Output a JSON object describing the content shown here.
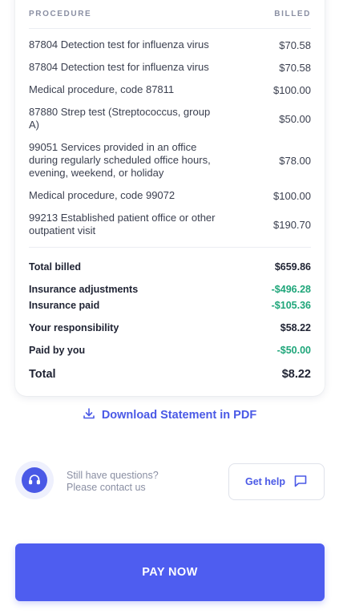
{
  "table": {
    "header_procedure": "PROCEDURE",
    "header_billed": "BILLED",
    "items": [
      {
        "description": "87804 Detection test for influenza virus",
        "amount": "$70.58"
      },
      {
        "description": "87804 Detection test for influenza virus",
        "amount": "$70.58"
      },
      {
        "description": "Medical procedure, code 87811",
        "amount": "$100.00"
      },
      {
        "description": "87880 Strep test (Streptococcus, group A)",
        "amount": "$50.00"
      },
      {
        "description": "99051 Services provided in an office during regularly scheduled office hours, evening, weekend, or holiday",
        "amount": "$78.00"
      },
      {
        "description": "Medical procedure, code 99072",
        "amount": "$100.00"
      },
      {
        "description": "99213 Established patient office or other outpatient visit",
        "amount": "$190.70"
      }
    ]
  },
  "summary": {
    "total_billed_label": "Total billed",
    "total_billed_value": "$659.86",
    "insurance_adjustments_label": "Insurance adjustments",
    "insurance_adjustments_value": "-$496.28",
    "insurance_paid_label": "Insurance paid",
    "insurance_paid_value": "-$105.36",
    "your_responsibility_label": "Your responsibility",
    "your_responsibility_value": "$58.22",
    "paid_by_you_label": "Paid by you",
    "paid_by_you_value": "-$50.00",
    "total_label": "Total",
    "total_value": "$8.22"
  },
  "download_label": "Download Statement in PDF",
  "help": {
    "line1": "Still have questions?",
    "line2": "Please contact us",
    "button_label": "Get help",
    "avatar_icon": "headset-icon",
    "button_icon": "chat-bubble-icon"
  },
  "pay_button_label": "PAY NOW",
  "colors": {
    "accent": "#4e5df0",
    "link": "#4a59e6",
    "credit": "#1fa67a"
  }
}
